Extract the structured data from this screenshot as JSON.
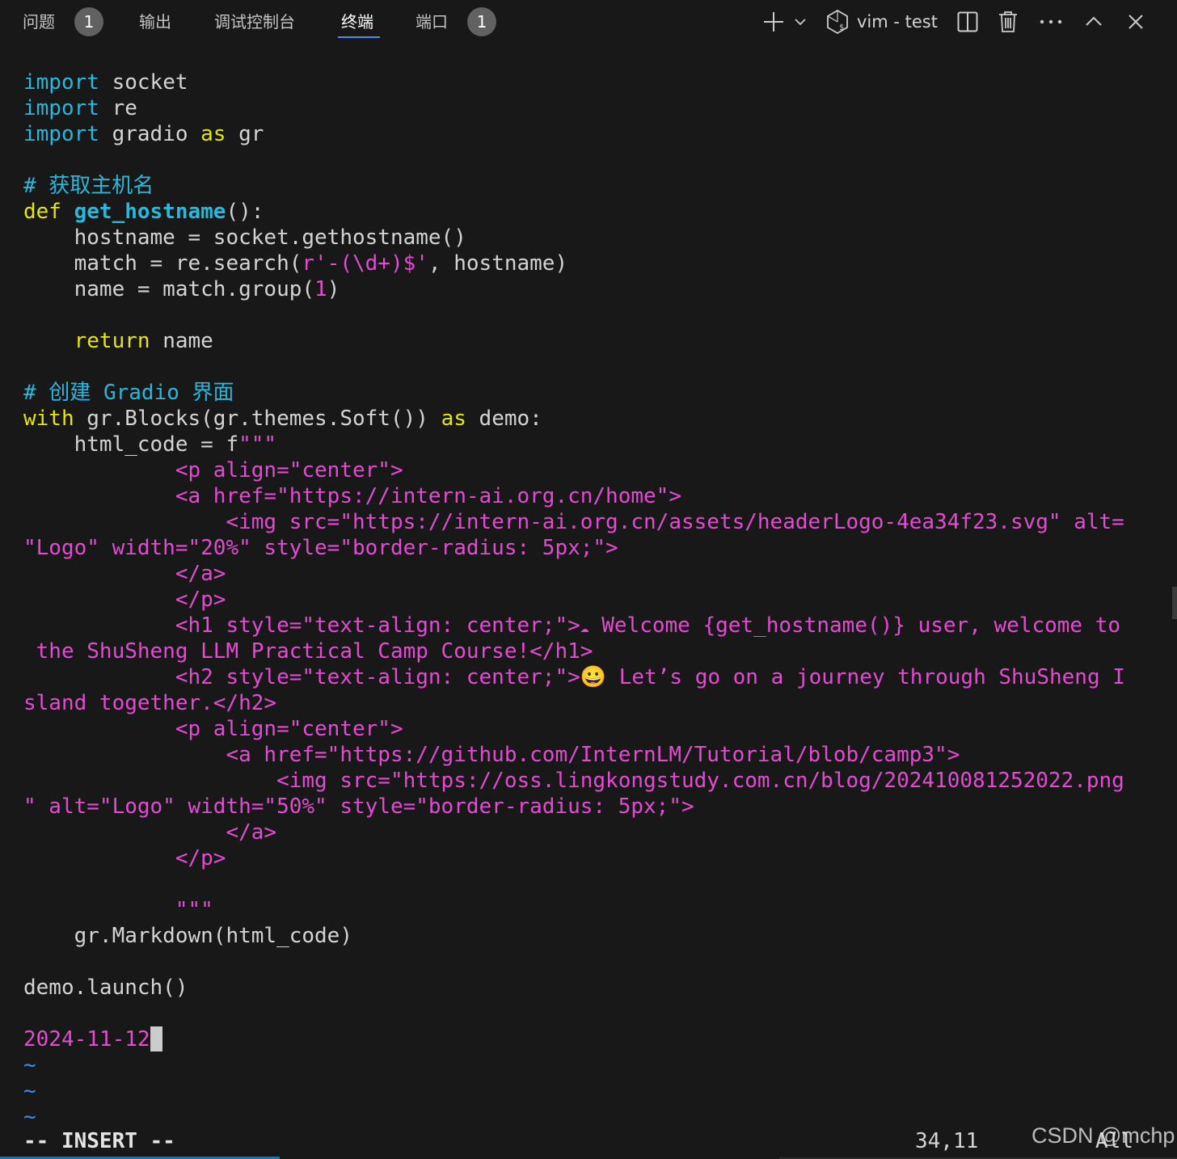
{
  "tabs": [
    {
      "label": "问题",
      "badge": "1"
    },
    {
      "label": "输出"
    },
    {
      "label": "调试控制台"
    },
    {
      "label": "终端",
      "active": true
    },
    {
      "label": "端口",
      "badge": "1"
    }
  ],
  "toolbar": {
    "terminal_name": "vim - test",
    "icons": [
      "plus-icon",
      "chevron-down-icon",
      "terminal-shell-icon",
      "split-editor-icon",
      "trash-icon",
      "more-icon",
      "chevron-up-icon",
      "close-icon"
    ]
  },
  "code": {
    "l1": [
      "import",
      " socket"
    ],
    "l2": [
      "import",
      " re"
    ],
    "l3": [
      "import",
      " gradio ",
      "as",
      " gr"
    ],
    "l4": [
      "# 获取主机名"
    ],
    "l5": [
      "def",
      " ",
      "get_hostname",
      "():"
    ],
    "l6": [
      "    hostname = socket.gethostname()"
    ],
    "l7": [
      "    match = re.search(",
      "r'-(\\d+)$'",
      ", hostname)"
    ],
    "l8": [
      "    name = match.group(",
      "1",
      ")"
    ],
    "l9": [
      "    ",
      "return",
      " name"
    ],
    "l10": [
      "# 创建 Gradio 界面"
    ],
    "l11": [
      "with",
      " gr.Blocks(gr.themes.Soft()) ",
      "as",
      " demo:"
    ],
    "l12": [
      "    html_code = f",
      "\"\"\""
    ],
    "l13": [
      "            <p align=\"center\">"
    ],
    "l14": [
      "            <a href=\"https://intern-ai.org.cn/home\">"
    ],
    "l15": [
      "                <img src=\"https://intern-ai.org.cn/assets/headerLogo-4ea34f23.svg\" alt="
    ],
    "l16": [
      "\"Logo\" width=\"20%\" style=\"border-radius: 5px;\">"
    ],
    "l17": [
      "            </a>"
    ],
    "l18": [
      "            </p>"
    ],
    "l19": [
      "            <h1 style=\"text-align: center;\">",
      "☁",
      " Welcome {get_hostname()} user, welcome to"
    ],
    "l20": [
      " the ShuSheng LLM Practical Camp Course!</h1>"
    ],
    "l21": [
      "            <h2 style=\"text-align: center;\">",
      "😀",
      " Let’s go on a journey through ShuSheng I"
    ],
    "l22": [
      "sland together.</h2>"
    ],
    "l23": [
      "            <p align=\"center\">"
    ],
    "l24": [
      "                <a href=\"https://github.com/InternLM/Tutorial/blob/camp3\">"
    ],
    "l25": [
      "                    <img src=\"https://oss.lingkongstudy.com.cn/blog/202410081252022.png"
    ],
    "l26": [
      "\" alt=\"Logo\" width=\"50%\" style=\"border-radius: 5px;\">"
    ],
    "l27": [
      "                </a>"
    ],
    "l28": [
      "            </p>"
    ],
    "l29": [
      "            \"\"\""
    ],
    "l30": [
      "    gr.Markdown(html_code)"
    ],
    "l31": [
      "demo.launch()"
    ],
    "l32": [
      "2024-11-12"
    ],
    "tilde": "~"
  },
  "status": {
    "mode": "-- INSERT --",
    "position": "34,11",
    "scroll": "All"
  },
  "watermark": "CSDN @mchp",
  "colors": {
    "background": "#181818",
    "keyword_cyan": "#29b8db",
    "keyword_yellow": "#e5e510",
    "string_magenta": "#e44bd3",
    "tilde_blue": "#3b8eea",
    "tab_underline": "#3794ff"
  }
}
